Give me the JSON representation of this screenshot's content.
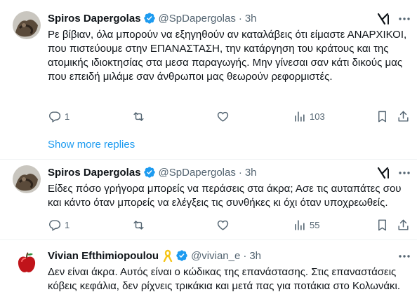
{
  "tweets": [
    {
      "name": "Spiros Dapergolas",
      "handle": "@SpDapergolas",
      "separator": "·",
      "time": "3h",
      "text": "Ρε βίβιαν, όλα μπορούν να εξηγηθούν αν καταλάβεις ότι είμαστε ΑΝΑΡΧΙΚΟΙ, που πιστεύουμε στην ΕΠΑΝΑΣΤΑΣΗ, την κατάργηση του κράτους και της ατομικής ιδιοκτησίας στα μεσα παραγωγής. Μην γίνεσαι σαν κάτι δικούς μας που επειδή μιλάμε σαν άνθρωποι μας θεωρούν ρεφορμιστές.",
      "replies": "1",
      "views": "103"
    },
    {
      "name": "Spiros Dapergolas",
      "handle": "@SpDapergolas",
      "separator": "·",
      "time": "3h",
      "text": "Είδες πόσο γρήγορα μπορείς να περάσεις στα άκρα; Ασε τις αυταπάτες σου και κάντο όταν μπορείς να ελέγξεις τις συνθήκες κι όχι όταν υποχρεωθείς.",
      "replies": "1",
      "views": "55"
    },
    {
      "name": "Vivian Efthimiopoulou",
      "handle": "@vivian_e",
      "separator": "·",
      "time": "3h",
      "text": "Δεν είναι άκρα. Αυτός είναι ο κώδικας της επανάστασης. Στις επαναστάσεις κόβεις κεφάλια, δεν ρίχνεις τρικάκια και μετά πας για ποτάκια στο Κολωνάκι."
    }
  ],
  "show_more": "Show more replies",
  "icons": [
    "verified-badge-icon",
    "grok-icon",
    "more-icon",
    "reply-icon",
    "retweet-icon",
    "like-icon",
    "views-icon",
    "bookmark-icon",
    "share-icon",
    "ribbon-icon",
    "apple-icon"
  ],
  "colors": {
    "accent": "#1d9bf0",
    "muted": "#536471",
    "text": "#0f1419",
    "ribbon": "#f5c518",
    "apple": "#c0141a"
  }
}
